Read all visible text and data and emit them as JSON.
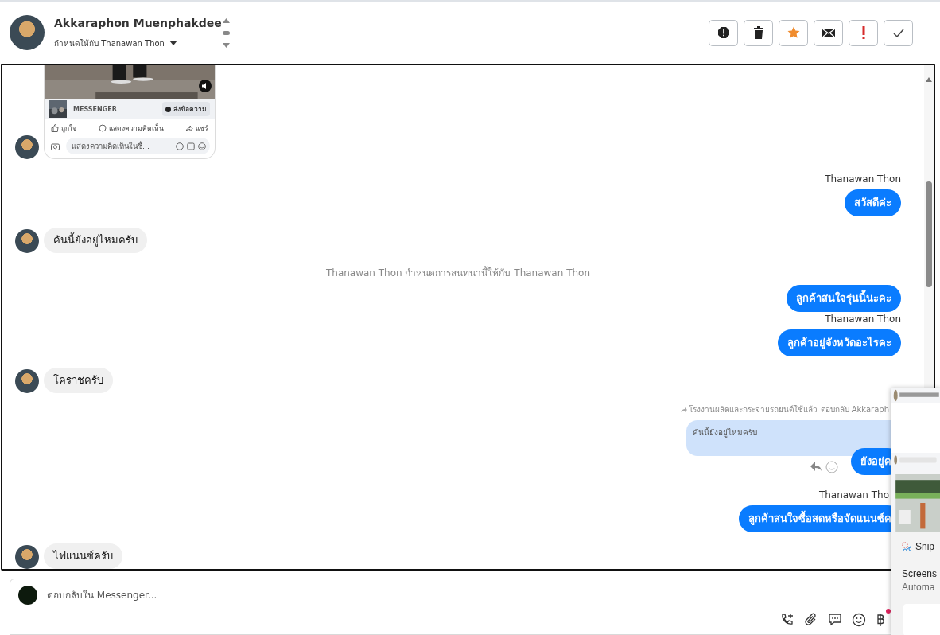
{
  "header": {
    "name": "Akkaraphon Muenphakdee",
    "assigned": "กำหนดให้กับ Thanawan Thon"
  },
  "messages": [
    {
      "kind": "post_card",
      "source": "MESSENGER",
      "send_button": "ส่งข้อความ",
      "actions": [
        "ถูกใจ",
        "แสดงความคิดเห็น",
        "แชร์"
      ],
      "comment_placeholder": "แสดงความคิดเห็นในชื่..."
    },
    {
      "kind": "sender_label",
      "text": "Thanawan Thon"
    },
    {
      "kind": "outgoing",
      "text": "สวัสดีค่ะ"
    },
    {
      "kind": "incoming",
      "text": "คันนี้ยังอยู่ไหมครับ"
    },
    {
      "kind": "system",
      "text": "Thanawan Thon กำหนดการสนทนานี้ให้กับ Thanawan Thon"
    },
    {
      "kind": "outgoing",
      "text": "ลูกค้าสนใจรุ่นนี้นะคะ"
    },
    {
      "kind": "sender_label",
      "text": "Thanawan Thon"
    },
    {
      "kind": "outgoing",
      "text": "ลูกค้าอยู่จังหวัดอะไรคะ"
    },
    {
      "kind": "incoming",
      "text": "โคราชครับ"
    },
    {
      "kind": "reply",
      "header": "โรงงานผลิตและกระจายรถยนต์ใช้แล้ว ตอบกลับ Akkaraph",
      "quote": "คันนี้ยังอยู่ไหมครับ",
      "text": "ยังอยู่ค"
    },
    {
      "kind": "sender_label",
      "text": "Thanawan Tho"
    },
    {
      "kind": "outgoing",
      "text": "ลูกค้าสนใจซื้อสดหรือจัดแนนซ์ค"
    },
    {
      "kind": "incoming",
      "text": "ไฟแนนซ์ครับ"
    }
  ],
  "composer": {
    "placeholder": "ตอบกลับใน Messenger..."
  },
  "notification": {
    "app": "Snip",
    "title": "Screens",
    "body": "Automa"
  }
}
